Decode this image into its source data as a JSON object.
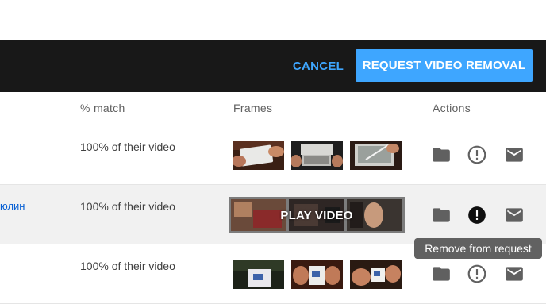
{
  "action_bar": {
    "cancel_label": "CANCEL",
    "request_label": "REQUEST VIDEO REMOVAL",
    "accent_color": "#3ea6ff",
    "background_color": "#181818"
  },
  "table": {
    "columns": [
      "% match",
      "Frames",
      "Actions"
    ],
    "rows": [
      {
        "channel": "",
        "match": "100% of their video",
        "frames": [
          "device-tablet-hands",
          "device-console-open",
          "device-stylus"
        ]
      },
      {
        "channel": "юлин",
        "match": "100% of their video",
        "frames": [
          "room-interior",
          "room-dark",
          "person-face"
        ],
        "overlay_label": "PLAY VIDEO"
      },
      {
        "channel": "",
        "match": "100% of their video",
        "frames": [
          "box-night",
          "box-in-hands",
          "box-opening"
        ]
      }
    ],
    "action_icons": [
      "folder-icon",
      "alert-circle-icon",
      "mail-icon"
    ]
  },
  "tooltip": {
    "text": "Remove from request"
  }
}
